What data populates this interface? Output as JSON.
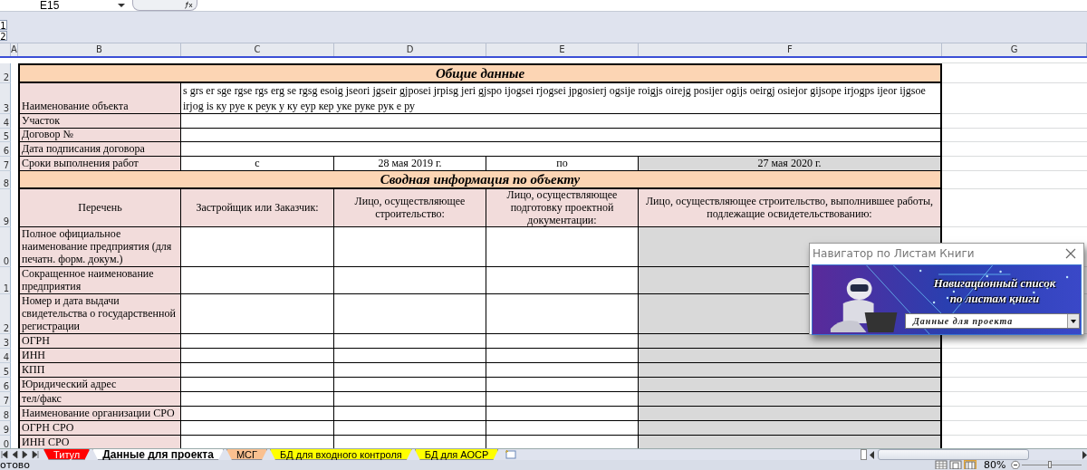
{
  "formula_bar": {
    "name_box": "E15"
  },
  "outline_levels": [
    "1",
    "2"
  ],
  "columns": [
    "A",
    "B",
    "C",
    "D",
    "E",
    "F",
    "G"
  ],
  "rows": [
    {
      "num": "2",
      "kind": "section",
      "title": "Общие данные"
    },
    {
      "num": "3",
      "kind": "field",
      "label": "Наименование объекта",
      "value": "s grs er sge rgse rgs erg se rgsg esoig jseori jgseir gjposei jrpisg jeri gjspo ijogsei rjogsei jpgosierj ogsije roigjs oirejg posijer ogijs oeirgj osiejor gijsope irjogps ijeor ijgsoe irjog is ку руе к реук у ку еур кер уке руке рук е ру"
    },
    {
      "num": "4",
      "kind": "field",
      "label": "Участок"
    },
    {
      "num": "5",
      "kind": "field",
      "label": "Договор №"
    },
    {
      "num": "6",
      "kind": "field",
      "label": "Дата подписания договора"
    },
    {
      "num": "7",
      "kind": "dates",
      "label": "Сроки выполнения работ",
      "from_label": "с",
      "from": "28 мая 2019 г.",
      "to_label": "по",
      "to": "27 мая 2020 г.",
      "shaded": true
    },
    {
      "num": "8",
      "kind": "section",
      "title": "Сводная информация по объекту"
    },
    {
      "num": "9",
      "kind": "header",
      "cells": [
        "Перечень",
        "Застройщик или Заказчик:",
        "Лицо, осуществляющее строительство:",
        "Лицо, осуществляющее подготовку проектной документации:",
        "Лицо, осуществляющее строительство, выполнившее работы, подлежащие освидетельствованию:"
      ]
    },
    {
      "num": "0",
      "kind": "entity",
      "label": "Полное официальное наименование  предприятия (для печатн. форм. докум.)",
      "shaded": true
    },
    {
      "num": "1",
      "kind": "entity",
      "label": "Сокращенное наименование предприятия",
      "shaded": true
    },
    {
      "num": "2",
      "kind": "entity",
      "label": "Номер и дата выдачи свидетельства о государственной регистрации",
      "shaded": true
    },
    {
      "num": "3",
      "kind": "entity",
      "label": "ОГРН",
      "shaded": true
    },
    {
      "num": "4",
      "kind": "entity",
      "label": "ИНН",
      "shaded": true
    },
    {
      "num": "5",
      "kind": "entity",
      "label": "КПП",
      "shaded": true
    },
    {
      "num": "6",
      "kind": "entity",
      "label": "Юридический адрес",
      "shaded": true
    },
    {
      "num": "7",
      "kind": "entity",
      "label": "тел/факс",
      "shaded": true
    },
    {
      "num": "8",
      "kind": "entity",
      "label": "Наименование организации СРО",
      "shaded": true
    },
    {
      "num": "9",
      "kind": "entity",
      "label": "ОГРН СРО",
      "shaded": true
    },
    {
      "num": "0",
      "kind": "entity",
      "label": "ИНН СРО",
      "shaded": true
    }
  ],
  "navigator": {
    "title": "Навигатор по Листам Книги",
    "banner_lines": [
      "Навигационный список",
      "по листам книги"
    ],
    "dropdown_value": "Данные для проекта"
  },
  "sheet_tabs": [
    {
      "label": "Титул",
      "color": "#ff0000",
      "selected": false
    },
    {
      "label": "Данные для проекта",
      "selected": true
    },
    {
      "label": "МСГ",
      "color": "#fac090",
      "selected": false
    },
    {
      "label": "БД для входного контроля",
      "color": "#ffff00",
      "selected": false
    },
    {
      "label": "БД для АОСР",
      "color": "#ffff00",
      "selected": false
    }
  ],
  "status_bar": {
    "status": "отово",
    "zoom": "80%",
    "zoom_slider": {
      "level": 0.47
    }
  }
}
